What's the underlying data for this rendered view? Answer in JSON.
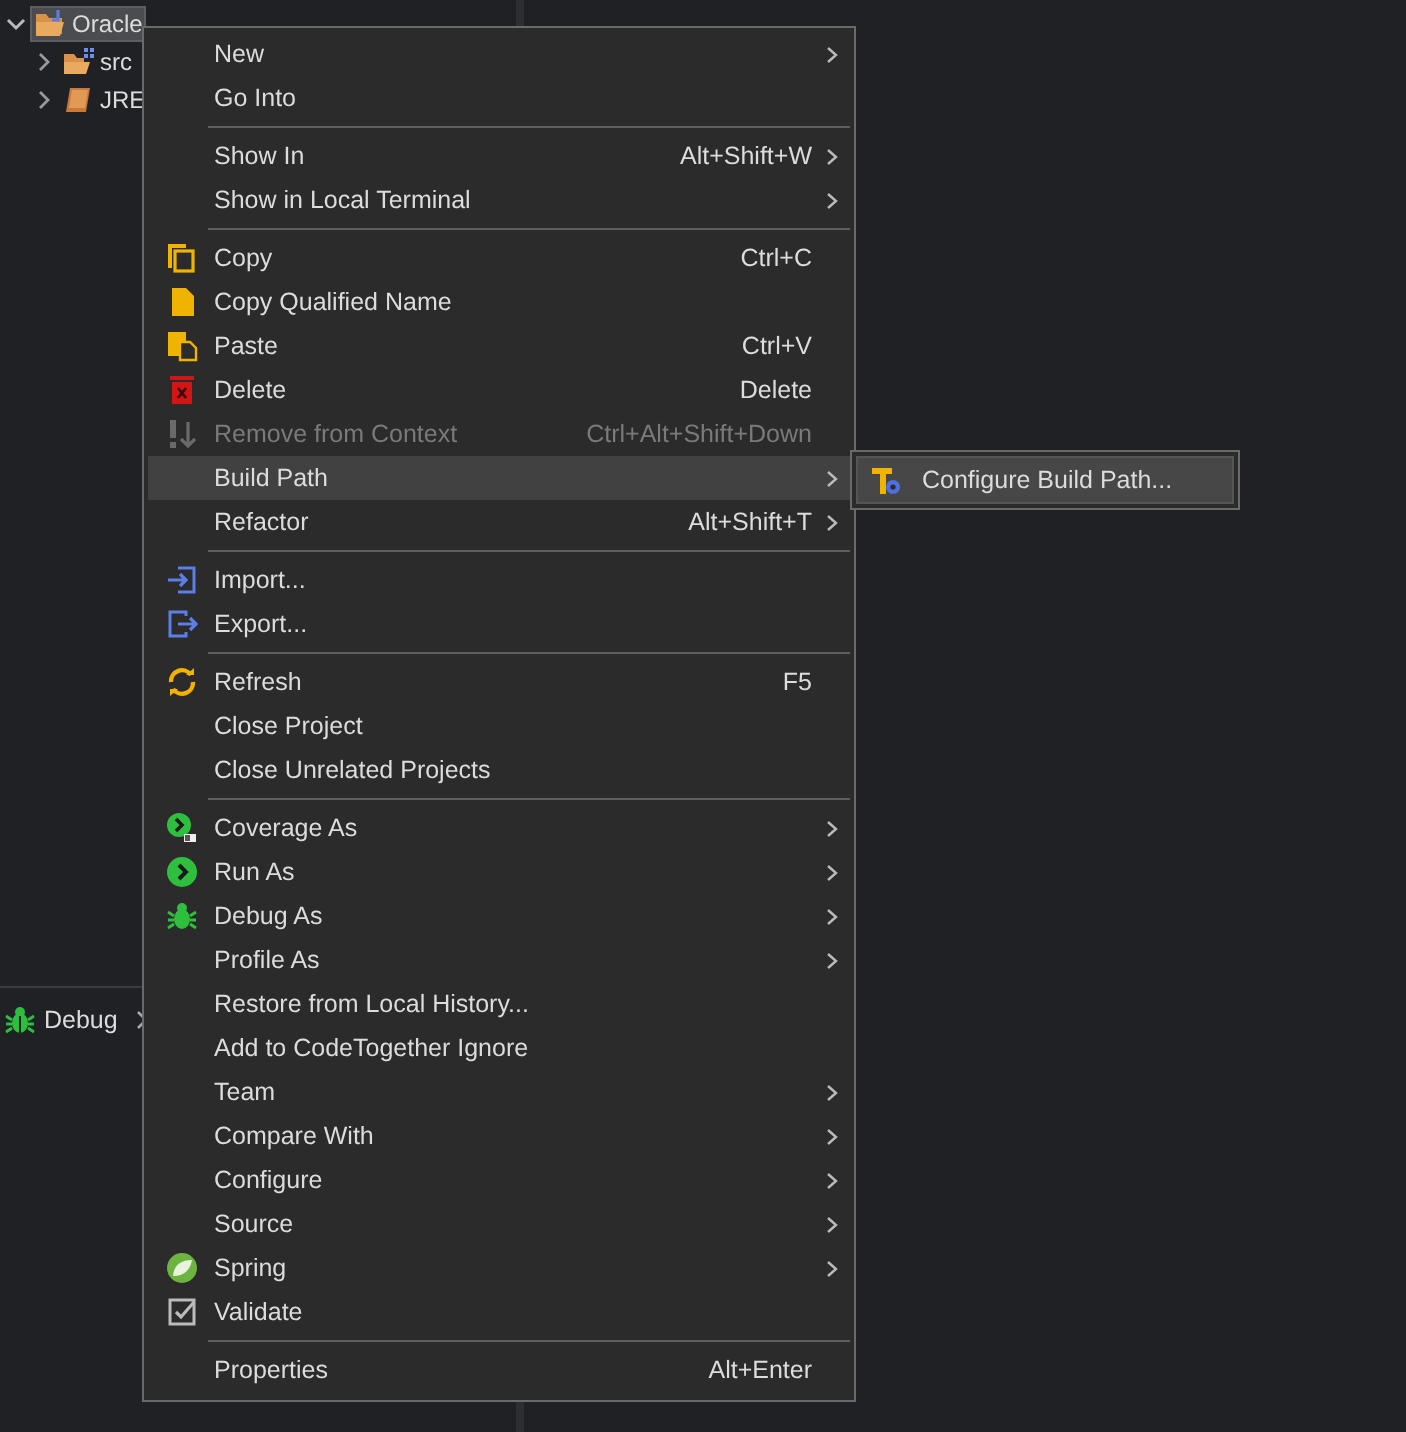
{
  "tree": [
    {
      "label": "Oracle",
      "expanded": true,
      "selected": true,
      "children": [
        {
          "label": "src",
          "expanded": false,
          "selected": false
        },
        {
          "label": "JRE",
          "expanded": false,
          "selected": false
        }
      ]
    }
  ],
  "debug_view": {
    "label": "Debug"
  },
  "context_menu": {
    "items": [
      {
        "kind": "item",
        "label": "New",
        "submenu": true,
        "disabled": false,
        "selected": false
      },
      {
        "kind": "item",
        "label": "Go Into",
        "submenu": false,
        "disabled": false,
        "selected": false
      },
      {
        "kind": "separator"
      },
      {
        "kind": "item",
        "label": "Show In",
        "shortcut": "Alt+Shift+W",
        "submenu": true,
        "disabled": false,
        "selected": false
      },
      {
        "kind": "item",
        "label": "Show in Local Terminal",
        "submenu": true,
        "disabled": false,
        "selected": false
      },
      {
        "kind": "separator"
      },
      {
        "kind": "item",
        "label": "Copy",
        "shortcut": "Ctrl+C",
        "submenu": false,
        "disabled": false,
        "selected": false
      },
      {
        "kind": "item",
        "label": "Copy Qualified Name",
        "submenu": false,
        "disabled": false,
        "selected": false
      },
      {
        "kind": "item",
        "label": "Paste",
        "shortcut": "Ctrl+V",
        "submenu": false,
        "disabled": false,
        "selected": false
      },
      {
        "kind": "item",
        "label": "Delete",
        "shortcut": "Delete",
        "submenu": false,
        "disabled": false,
        "selected": false
      },
      {
        "kind": "item",
        "label": "Remove from Context",
        "shortcut": "Ctrl+Alt+Shift+Down",
        "submenu": false,
        "disabled": true,
        "selected": false
      },
      {
        "kind": "item",
        "label": "Build Path",
        "submenu": true,
        "disabled": false,
        "selected": true
      },
      {
        "kind": "item",
        "label": "Refactor",
        "shortcut": "Alt+Shift+T",
        "submenu": true,
        "disabled": false,
        "selected": false
      },
      {
        "kind": "separator"
      },
      {
        "kind": "item",
        "label": "Import...",
        "submenu": false,
        "disabled": false,
        "selected": false
      },
      {
        "kind": "item",
        "label": "Export...",
        "submenu": false,
        "disabled": false,
        "selected": false
      },
      {
        "kind": "separator"
      },
      {
        "kind": "item",
        "label": "Refresh",
        "shortcut": "F5",
        "submenu": false,
        "disabled": false,
        "selected": false
      },
      {
        "kind": "item",
        "label": "Close Project",
        "submenu": false,
        "disabled": false,
        "selected": false
      },
      {
        "kind": "item",
        "label": "Close Unrelated Projects",
        "submenu": false,
        "disabled": false,
        "selected": false
      },
      {
        "kind": "separator"
      },
      {
        "kind": "item",
        "label": "Coverage As",
        "submenu": true,
        "disabled": false,
        "selected": false
      },
      {
        "kind": "item",
        "label": "Run As",
        "submenu": true,
        "disabled": false,
        "selected": false
      },
      {
        "kind": "item",
        "label": "Debug As",
        "submenu": true,
        "disabled": false,
        "selected": false
      },
      {
        "kind": "item",
        "label": "Profile As",
        "submenu": true,
        "disabled": false,
        "selected": false
      },
      {
        "kind": "item",
        "label": "Restore from Local History...",
        "submenu": false,
        "disabled": false,
        "selected": false
      },
      {
        "kind": "item",
        "label": "Add to CodeTogether Ignore",
        "submenu": false,
        "disabled": false,
        "selected": false
      },
      {
        "kind": "item",
        "label": "Team",
        "submenu": true,
        "disabled": false,
        "selected": false
      },
      {
        "kind": "item",
        "label": "Compare With",
        "submenu": true,
        "disabled": false,
        "selected": false
      },
      {
        "kind": "item",
        "label": "Configure",
        "submenu": true,
        "disabled": false,
        "selected": false
      },
      {
        "kind": "item",
        "label": "Source",
        "submenu": true,
        "disabled": false,
        "selected": false
      },
      {
        "kind": "item",
        "label": "Spring",
        "submenu": true,
        "disabled": false,
        "selected": false
      },
      {
        "kind": "item",
        "label": "Validate",
        "submenu": false,
        "disabled": false,
        "selected": false
      },
      {
        "kind": "separator"
      },
      {
        "kind": "item",
        "label": "Properties",
        "shortcut": "Alt+Enter",
        "submenu": false,
        "disabled": false,
        "selected": false
      }
    ]
  },
  "submenu": {
    "items": [
      {
        "label": "Configure Build Path...",
        "selected": true
      }
    ]
  }
}
